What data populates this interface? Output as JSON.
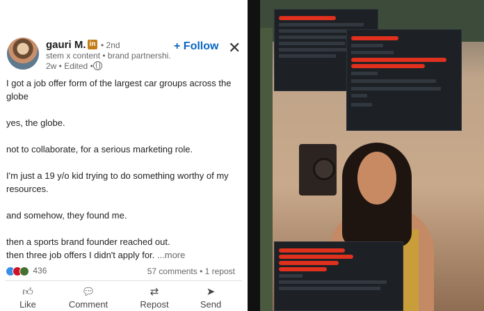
{
  "author": {
    "name": "gauri M.",
    "badge": "in",
    "degree": "• 2nd",
    "headline": "stem x content • brand partnershi...",
    "meta": "2w • Edited •"
  },
  "actions_top": {
    "follow_label": "+ Follow",
    "close_label": "✕"
  },
  "post": {
    "lines": [
      "I got a job offer form of the largest car groups across the globe",
      "yes, the globe.",
      "not to collaborate, for a serious marketing role.",
      "I'm just a 19 y/o kid trying to do something worthy of my resources.",
      "and somehow, they found me.",
      "then a sports brand founder reached out.",
      "then three job offers I didn't apply for."
    ],
    "more_label": "...more"
  },
  "social": {
    "reaction_count": "436",
    "comments_reposts": "57 comments • 1 repost"
  },
  "buttons": {
    "like": "Like",
    "comment": "Comment",
    "repost": "Repost",
    "send": "Send"
  },
  "icons": {
    "like": "thumbs-up-icon",
    "comment": "speech-bubble-icon",
    "repost": "repost-arrows-icon",
    "send": "paper-plane-icon"
  },
  "colors": {
    "accent": "#0a66c2",
    "redaction": "#e0301e"
  }
}
